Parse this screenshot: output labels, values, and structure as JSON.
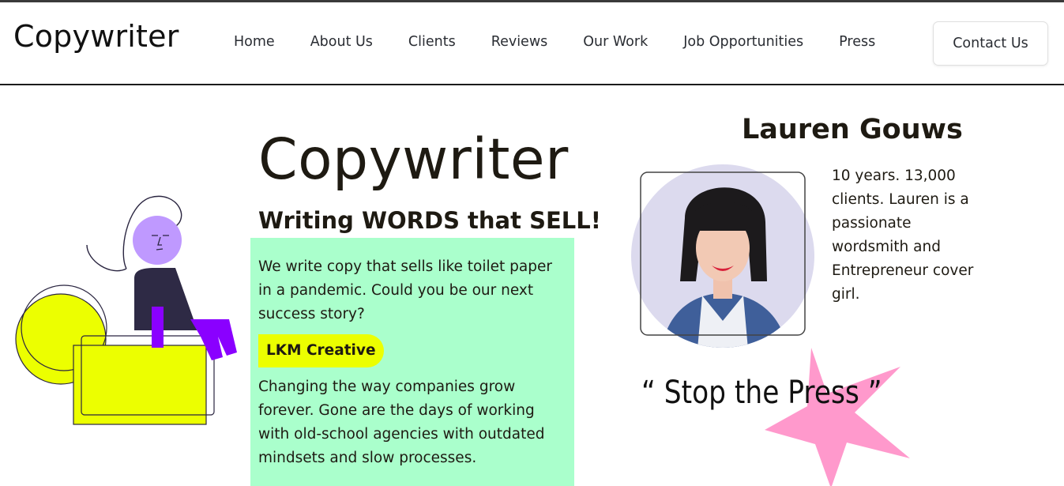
{
  "header": {
    "logo": "Copywriter",
    "nav": [
      "Home",
      "About Us",
      "Clients",
      "Reviews",
      "Our Work",
      "Job Opportunities",
      "Press"
    ],
    "contact_label": "Contact Us"
  },
  "hero": {
    "title": "Copywriter",
    "subtitle": "Writing WORDS that SELL!",
    "intro": "We write copy that sells like toilet paper in a pandemic. Could you be our next success story?",
    "badge": "LKM Creative",
    "body": "Changing the way companies grow forever. Gone are the days of working with old-school agencies with outdated mindsets and slow processes."
  },
  "profile": {
    "name": "Lauren Gouws",
    "bio": "10 years. 13,000 clients. Lauren is a passionate wordsmith and Entrepreneur cover girl."
  },
  "press": {
    "quote": "“ Stop the Press ”"
  },
  "colors": {
    "accent_yellow": "#ecff00",
    "card_green": "#aaffcc",
    "purple": "#8a00ff",
    "lilac": "#bf99ff",
    "star_pink": "#ff99cc"
  }
}
